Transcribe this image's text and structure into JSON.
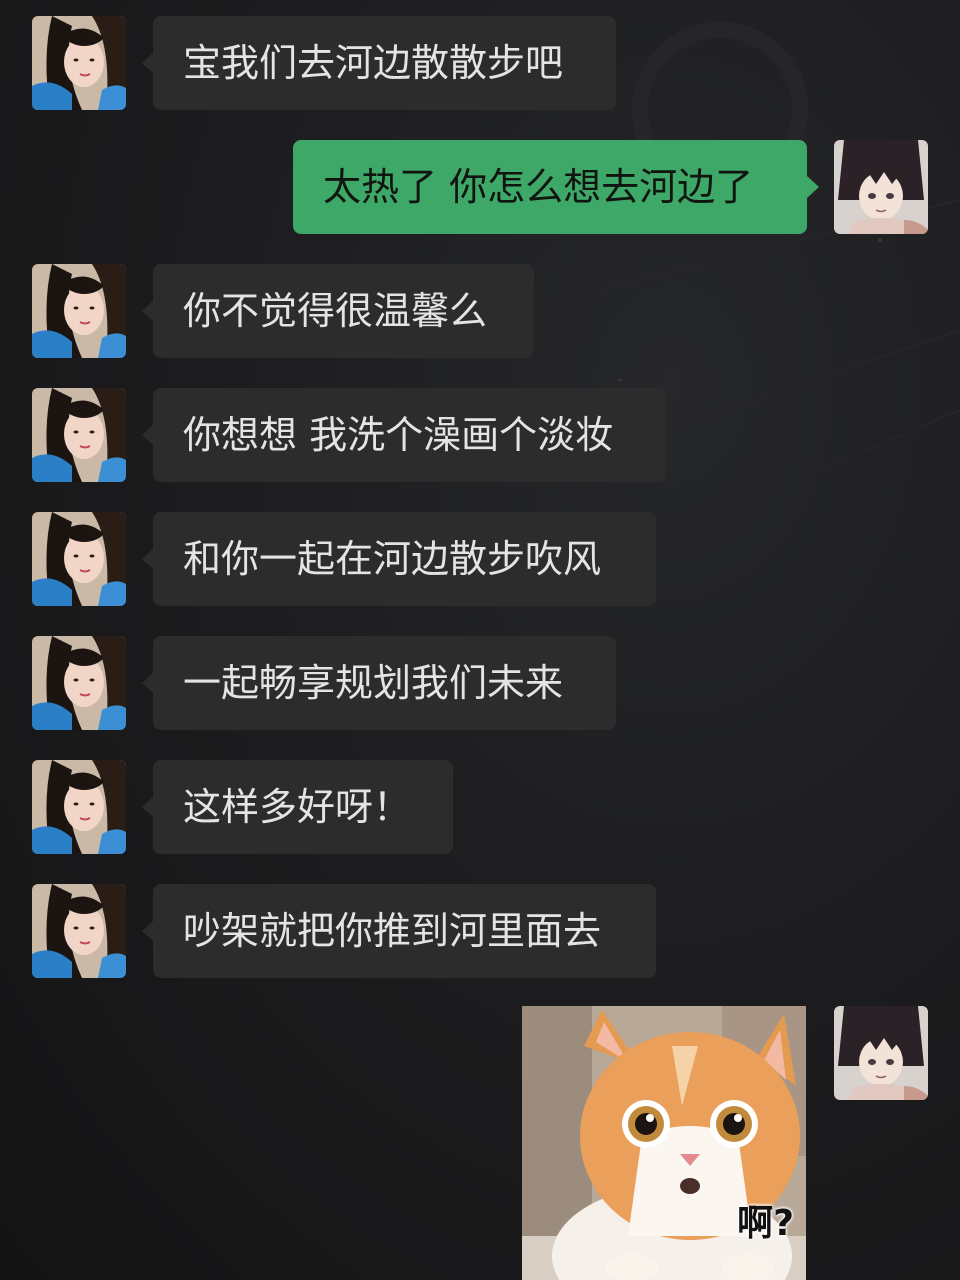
{
  "chat": {
    "messages": [
      {
        "side": "left",
        "text": "宝我们去河边散散步吧"
      },
      {
        "side": "right",
        "text": "太热了 你怎么想去河边了"
      },
      {
        "side": "left",
        "text": "你不觉得很温馨么"
      },
      {
        "side": "left",
        "text": "你想想 我洗个澡画个淡妆"
      },
      {
        "side": "left",
        "text": "和你一起在河边散步吹风"
      },
      {
        "side": "left",
        "text": "一起畅享规划我们未来"
      },
      {
        "side": "left",
        "text": "这样多好呀！"
      },
      {
        "side": "left",
        "text": "吵架就把你推到河里面去"
      }
    ],
    "sticker": {
      "caption": "啊?",
      "subject": "surprised orange and white kitten"
    }
  },
  "colors": {
    "background": "#1a1a1c",
    "bubble_left": "#2c2c2c",
    "bubble_right": "#3ea868",
    "text_left": "#e4e4e4",
    "text_right": "#101510"
  }
}
